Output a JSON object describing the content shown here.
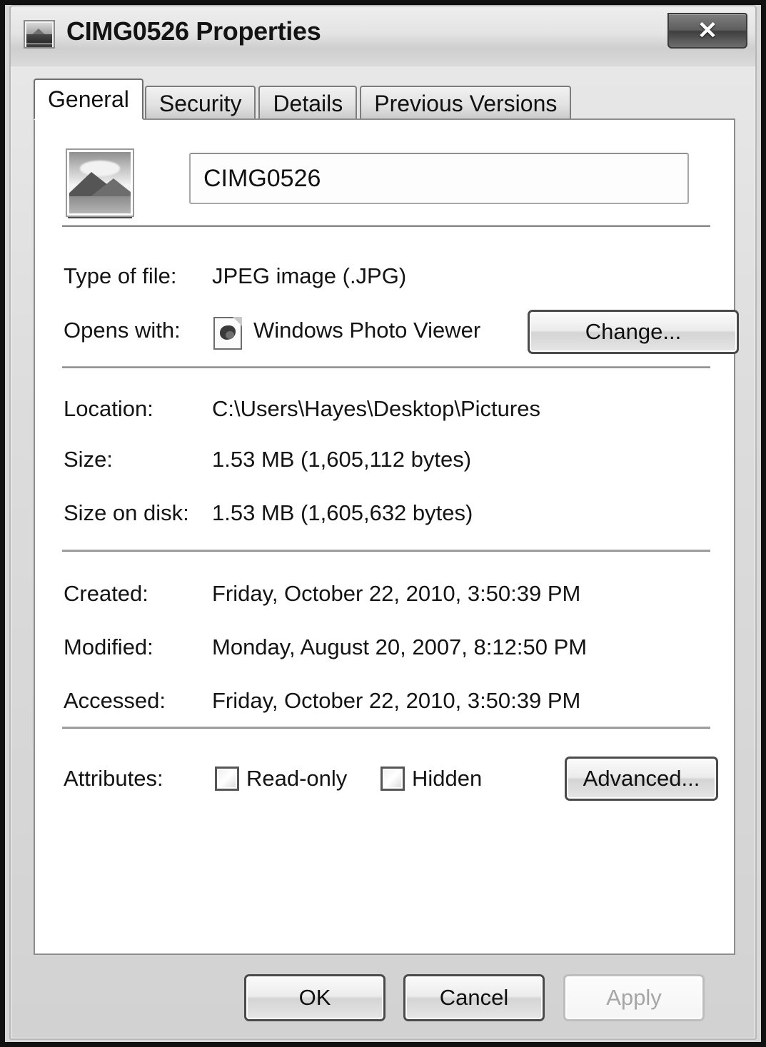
{
  "window": {
    "title": "CIMG0526 Properties",
    "title_icon": "image-file-icon",
    "close_label": "✕"
  },
  "tabs": [
    {
      "label": "General",
      "active": true
    },
    {
      "label": "Security",
      "active": false
    },
    {
      "label": "Details",
      "active": false
    },
    {
      "label": "Previous Versions",
      "active": false
    }
  ],
  "general": {
    "file_icon": "photo-thumbnail-icon",
    "filename": "CIMG0526",
    "type_of_file": {
      "label": "Type of file:",
      "value": "JPEG image (.JPG)"
    },
    "opens_with": {
      "label": "Opens with:",
      "app_icon": "windows-photo-viewer-icon",
      "value": "Windows Photo Viewer",
      "change_button": "Change..."
    },
    "location": {
      "label": "Location:",
      "value": "C:\\Users\\Hayes\\Desktop\\Pictures"
    },
    "size": {
      "label": "Size:",
      "value": "1.53 MB (1,605,112 bytes)"
    },
    "size_on_disk": {
      "label": "Size on disk:",
      "value": "1.53 MB (1,605,632 bytes)"
    },
    "created": {
      "label": "Created:",
      "value": "Friday, October 22, 2010, 3:50:39 PM"
    },
    "modified": {
      "label": "Modified:",
      "value": "Monday, August 20, 2007, 8:12:50 PM"
    },
    "accessed": {
      "label": "Accessed:",
      "value": "Friday, October 22, 2010, 3:50:39 PM"
    },
    "attributes": {
      "label": "Attributes:",
      "read_only": {
        "label": "Read-only",
        "checked": false
      },
      "hidden": {
        "label": "Hidden",
        "checked": false
      },
      "advanced_button": "Advanced..."
    }
  },
  "footer": {
    "ok": "OK",
    "cancel": "Cancel",
    "apply": "Apply",
    "apply_disabled": true
  }
}
